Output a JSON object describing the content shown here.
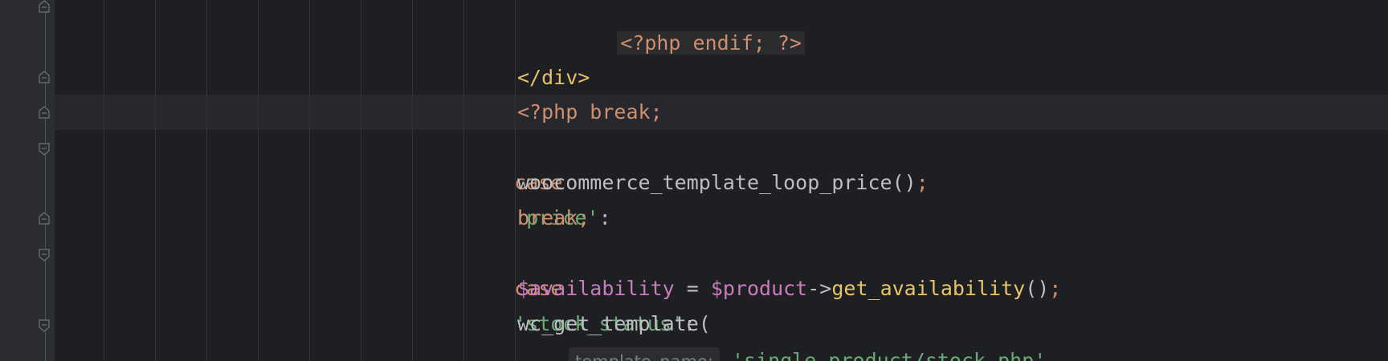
{
  "editor": {
    "lines": [
      {
        "id": "endif",
        "php_text": "<?php endif; ?>"
      },
      {
        "id": "close-div",
        "text": "</div>"
      },
      {
        "id": "break-php",
        "text": "<?php break;"
      },
      {
        "id": "case-price",
        "kw": "case",
        "str": "'price'",
        "punct": ":"
      },
      {
        "id": "price-call",
        "fn": "woocommerce_template_loop_price",
        "parens": "()",
        "semi": ";"
      },
      {
        "id": "break-1",
        "text": "break;"
      },
      {
        "id": "case-stock",
        "kw": "case",
        "str": "'stock_status'",
        "punct": ":"
      },
      {
        "id": "availability",
        "var1": "$availability",
        "op": " = ",
        "var2": "$product",
        "arrow": "->",
        "method": "get_availability",
        "parens": "()",
        "semi": ";"
      },
      {
        "id": "wc-get-template",
        "fn": "wc_get_template("
      },
      {
        "id": "template-arg",
        "hint": "template_name:",
        "str": "'single-product/stock.php'"
      }
    ]
  },
  "colors": {
    "background": "#1e1f22",
    "gutter": "#2b2d30",
    "keyword": "#cf8e6d",
    "string": "#6aab73",
    "variable": "#c77dbb",
    "tag": "#e8bf6a",
    "method": "#e8c46a",
    "text": "#bcbec4"
  }
}
